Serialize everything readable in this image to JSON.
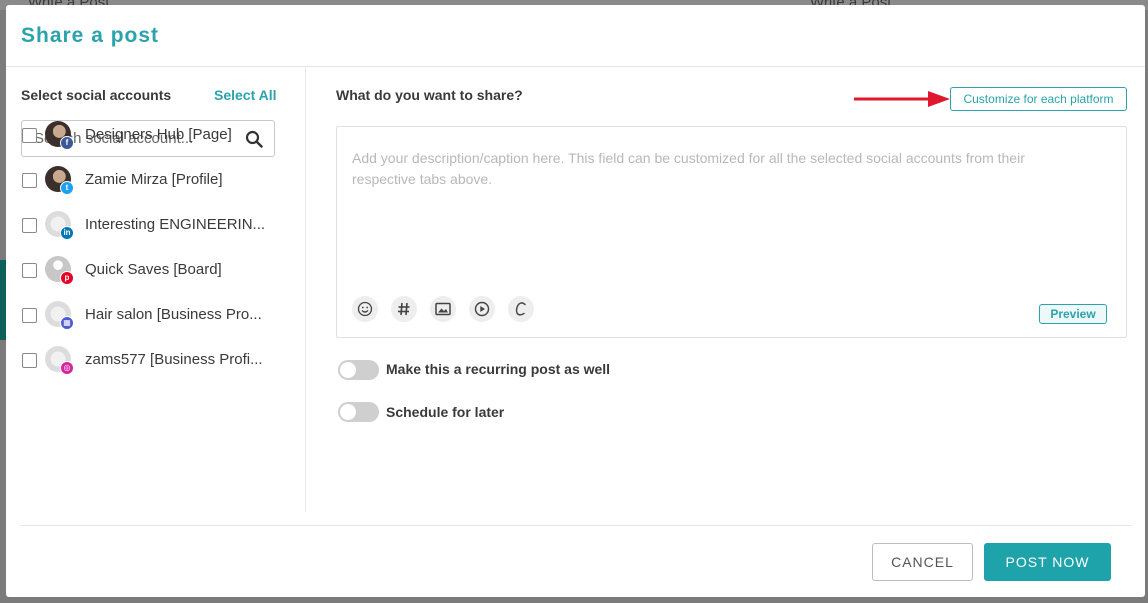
{
  "modal": {
    "title": "Share a post"
  },
  "accounts_panel": {
    "heading": "Select social accounts",
    "select_all": "Select All",
    "search_placeholder": "Search social account...",
    "items": [
      {
        "name": "Designers Hub [Page]",
        "network": "facebook",
        "badge_color": "#3b5998",
        "badge_glyph": "f"
      },
      {
        "name": "Zamie Mirza [Profile]",
        "network": "twitter",
        "badge_color": "#1da1f2",
        "badge_glyph": "t"
      },
      {
        "name": "Interesting ENGINEERIN...",
        "network": "linkedin",
        "badge_color": "#0077b5",
        "badge_glyph": "in"
      },
      {
        "name": "Quick Saves [Board]",
        "network": "pinterest",
        "badge_color": "#e60023",
        "badge_glyph": "p"
      },
      {
        "name": "Hair salon [Business Pro...",
        "network": "google-business",
        "badge_color": "#4a5bd4",
        "badge_glyph": "▦"
      },
      {
        "name": "zams577 [Business Profi...",
        "network": "instagram",
        "badge_color": "#d6249f",
        "badge_glyph": "◎"
      }
    ]
  },
  "composer": {
    "heading": "What do you want to share?",
    "customize_label": "Customize for each platform",
    "caption_placeholder": "Add your description/caption here. This field can be customized for all the selected social accounts from their respective tabs above.",
    "preview_label": "Preview",
    "tools": [
      "emoji-icon",
      "hashtag-icon",
      "image-icon",
      "video-icon",
      "caption-generator-icon"
    ]
  },
  "options": {
    "recurring_label": "Make this a recurring post as well",
    "schedule_label": "Schedule for later",
    "recurring_on": false,
    "schedule_on": false
  },
  "footer": {
    "cancel_label": "CANCEL",
    "post_label": "POST NOW"
  },
  "background": {
    "left_text": "Write a Post",
    "right_text": "Write a Post"
  },
  "colors": {
    "accent": "#2aa3ad",
    "arrow": "#e0182d"
  }
}
